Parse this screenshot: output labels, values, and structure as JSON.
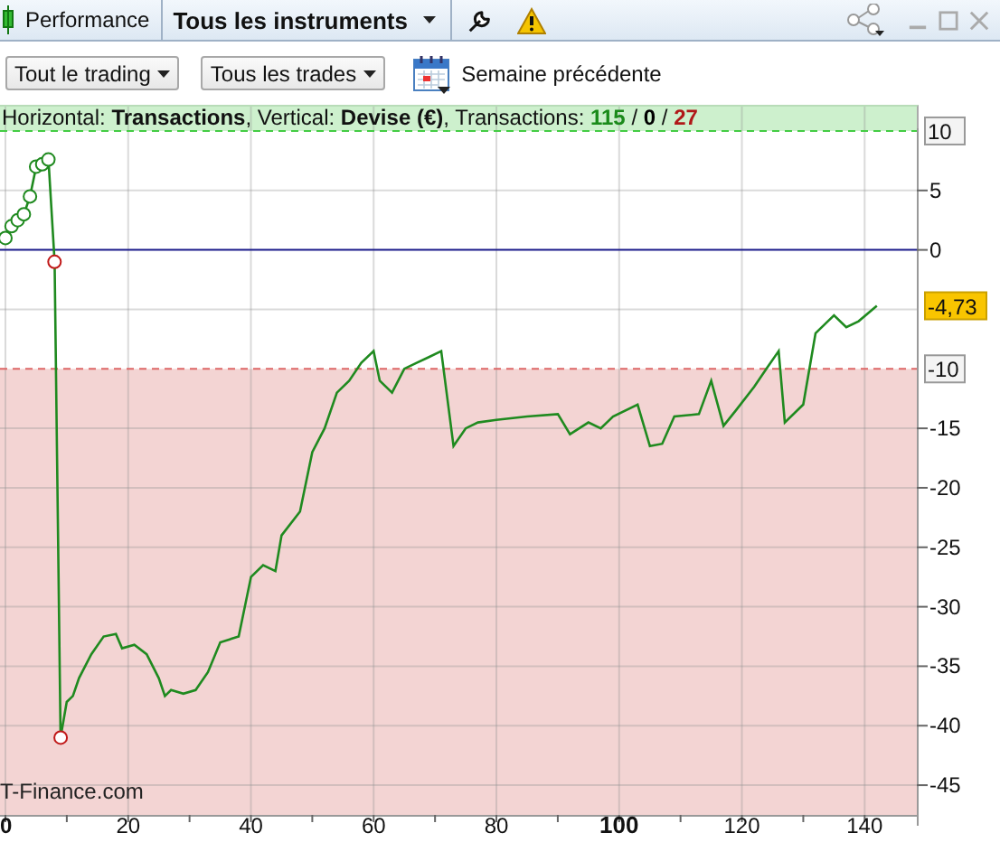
{
  "toolbar": {
    "tabs": [
      {
        "label": "Performance",
        "kind": "tab"
      },
      {
        "label": "Tous les instruments",
        "kind": "dropdown"
      }
    ]
  },
  "filters": {
    "dropdowns": [
      "Tout le trading",
      "Tous les trades"
    ],
    "period": "Semaine précédente"
  },
  "info": {
    "text": "Horizontal: **Transactions**, Vertical: **Devise (€)**, Transactions: ",
    "counts": [
      {
        "label": "115",
        "color": "#1a8a1a"
      },
      {
        "label": "0",
        "color": "#000000"
      },
      {
        "label": "27",
        "color": "#b01818"
      }
    ],
    "separator": "/"
  },
  "watermark": "T-Finance.com",
  "chart": {
    "current_value": "-4,73",
    "chart_data": {
      "type": "line",
      "grid": true,
      "xlim": [
        0,
        148.5
      ],
      "ylim": [
        -47.5,
        12.2
      ],
      "xticks": [
        {
          "value": 0,
          "label": "0"
        },
        20,
        40,
        60,
        80,
        {
          "value": 100,
          "label": "100"
        },
        120,
        140
      ],
      "yticks": [
        5,
        0,
        -15,
        -20,
        -25,
        -30,
        -35,
        -40,
        -45
      ],
      "bands": [
        {
          "axis": "y",
          "from": 10,
          "to": 12.2,
          "color": "#cdf0cd"
        },
        {
          "axis": "y",
          "from": -47.5,
          "to": -10,
          "color": "#f3d4d3"
        }
      ],
      "ref_lines": [
        {
          "axis": "y",
          "value": 10,
          "color": "#44cc44"
        },
        {
          "axis": "y",
          "value": -10,
          "color": "#dd6666"
        },
        {
          "axis": "y",
          "value": 0,
          "color": "#1a1a8a"
        }
      ],
      "series": [
        {
          "color": "#1f8a1f",
          "x": [
            0,
            1,
            2,
            3,
            4,
            5,
            6,
            7,
            8,
            9,
            10,
            11,
            12,
            14,
            16,
            18,
            19,
            21,
            23,
            25,
            26,
            27,
            29,
            31,
            33,
            35,
            38,
            40,
            42,
            44,
            45,
            48,
            50,
            52,
            54,
            56,
            58,
            60,
            61,
            63,
            65,
            67,
            69,
            71,
            73,
            75,
            77,
            80,
            85,
            90,
            92,
            95,
            97,
            99,
            103,
            105,
            107,
            109,
            113,
            115,
            117,
            119,
            122,
            124,
            126,
            127,
            130,
            132,
            134,
            135,
            137,
            139,
            142
          ],
          "values": [
            1,
            2,
            2.5,
            3,
            4.5,
            7,
            7.2,
            7.6,
            -1,
            -41,
            -38,
            -37.5,
            -36,
            -34,
            -32.5,
            -32.3,
            -33.5,
            -33.2,
            -34,
            -36,
            -37.5,
            -37,
            -37.3,
            -37,
            -35.5,
            -33,
            -32.5,
            -27.5,
            -26.5,
            -27,
            -24,
            -22,
            -17,
            -15,
            -12,
            -11,
            -9.5,
            -8.5,
            -11,
            -12,
            -10,
            -9.5,
            -9,
            -8.5,
            -16.5,
            -15,
            -14.5,
            -14.3,
            -14,
            -13.8,
            -15.5,
            -14.5,
            -15,
            -14,
            -13,
            -16.5,
            -16.3,
            -14,
            -13.8,
            -11,
            -14.8,
            -13.5,
            -11.5,
            -10,
            -8.5,
            -14.5,
            -13,
            -7,
            -6,
            -5.5,
            -6.5,
            -6,
            -4.7
          ]
        }
      ],
      "annotations": [
        "10",
        "-10"
      ]
    }
  }
}
